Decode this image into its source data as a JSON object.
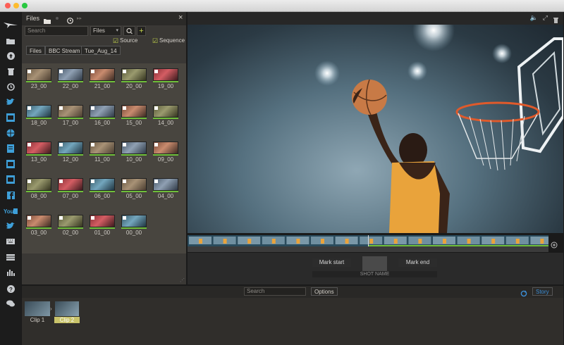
{
  "files_panel": {
    "title": "Files",
    "search_placeholder": "Search",
    "filter_select": "Files",
    "source_label": "Source",
    "sequence_label": "Sequence",
    "breadcrumbs": [
      "Files",
      "BBC Stream",
      "Tue_Aug_14"
    ],
    "clips": [
      "23_00",
      "22_00",
      "21_00",
      "20_00",
      "19_00",
      "18_00",
      "17_00",
      "16_00",
      "15_00",
      "14_00",
      "13_00",
      "12_00",
      "11_00",
      "10_00",
      "09_00",
      "08_00",
      "07_00",
      "06_00",
      "05_00",
      "04_00",
      "03_00",
      "02_00",
      "01_00",
      "00_00"
    ]
  },
  "player": {
    "mark_start": "Mark start",
    "mark_end": "Mark end",
    "shot_name_placeholder": "SHOT NAME"
  },
  "story": {
    "search_placeholder": "Search",
    "options_label": "Options",
    "story_label": "Story",
    "clips": [
      {
        "label": "Clip 1",
        "selected": false
      },
      {
        "label": "Clip 2",
        "selected": true
      }
    ]
  },
  "colors": {
    "accent_green": "#6fbf3a",
    "story_selected": "#c9c36a",
    "accent_blue": "#3d8fd6"
  }
}
